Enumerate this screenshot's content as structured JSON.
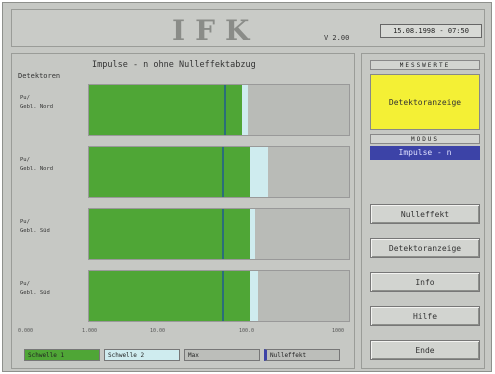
{
  "header": {
    "logo": "IFK",
    "version": "V 2.00",
    "datetime": "15.08.1998 - 07:50"
  },
  "main": {
    "title": "Impulse  -  n  ohne Nulleffektabzug",
    "detectors_label": "Detektoren",
    "rows": [
      {
        "label_1": "Pu/",
        "label_2": "Gebl. Nord",
        "green_fill": 0.59,
        "cyan_start": 0.59,
        "cyan_end": 0.61,
        "marker": 0.52
      },
      {
        "label_1": "Pu/",
        "label_2": "Gebl. Nord",
        "green_fill": 0.62,
        "cyan_start": 0.62,
        "cyan_end": 0.69,
        "marker": 0.51
      },
      {
        "label_1": "Pu/",
        "label_2": "Gebl. Süd",
        "green_fill": 0.62,
        "cyan_start": 0.62,
        "cyan_end": 0.64,
        "marker": 0.51
      },
      {
        "label_1": "Pu/",
        "label_2": "Gebl. Süd",
        "green_fill": 0.62,
        "cyan_start": 0.62,
        "cyan_end": 0.65,
        "marker": 0.51
      }
    ],
    "scale": [
      "0.000",
      "1.000",
      "10.00",
      "100.0",
      "1000"
    ],
    "legend": {
      "item_1": "Schwelle 1",
      "item_2": "Schwelle 2",
      "item_3": "Max",
      "item_4": "Nulleffekt"
    },
    "colors": {
      "green": "#4fa636",
      "cyan": "#cfecef",
      "marker": "#2b6e7a"
    }
  },
  "right": {
    "section_1": "MESSWERTE",
    "yellow_text": "Detektoranzeige",
    "section_2": "MODUS",
    "mode_value": "Impulse - n",
    "buttons": [
      "Nulleffekt",
      "Detektoranzeige",
      "Info",
      "Hilfe",
      "Ende"
    ]
  }
}
